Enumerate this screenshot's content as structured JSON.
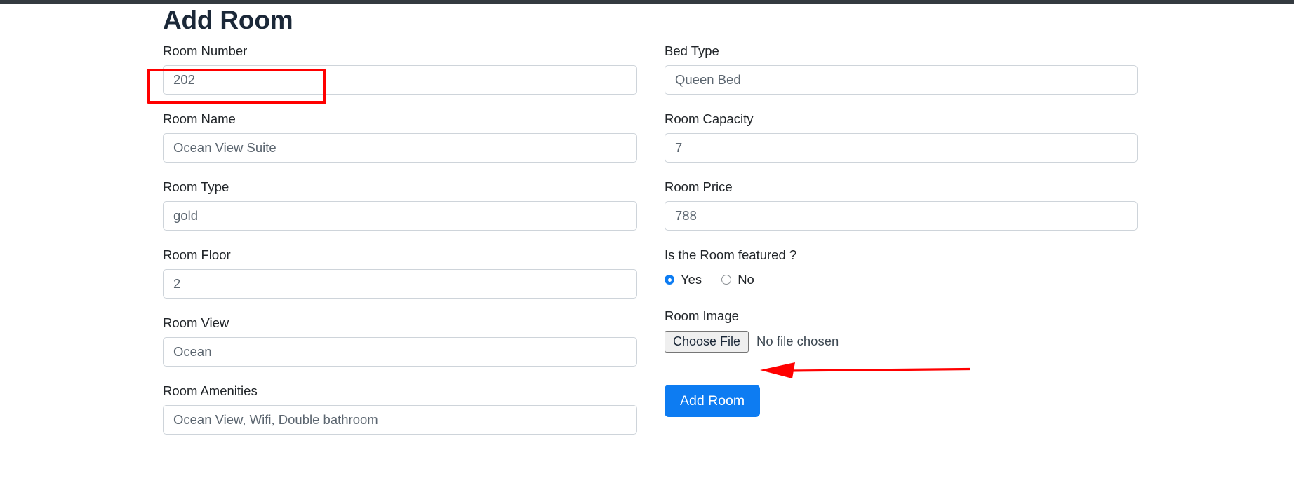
{
  "page": {
    "title": "Add Room"
  },
  "form": {
    "left_fields": [
      {
        "label": "Room Number",
        "value": "202",
        "name": "room-number"
      },
      {
        "label": "Room Name",
        "value": "Ocean View Suite",
        "name": "room-name"
      },
      {
        "label": "Room Type",
        "value": "gold",
        "name": "room-type"
      },
      {
        "label": "Room Floor",
        "value": "2",
        "name": "room-floor"
      },
      {
        "label": "Room View",
        "value": "Ocean",
        "name": "room-view"
      },
      {
        "label": "Room Amenities",
        "value": "Ocean View, Wifi, Double bathroom",
        "name": "room-amenities"
      }
    ],
    "right_fields": [
      {
        "label": "Bed Type",
        "value": "Queen Bed",
        "name": "bed-type"
      },
      {
        "label": "Room Capacity",
        "value": "7",
        "name": "room-capacity"
      },
      {
        "label": "Room Price",
        "value": "788",
        "name": "room-price"
      }
    ],
    "featured": {
      "label": "Is the Room featured ?",
      "options": [
        {
          "label": "Yes",
          "selected": true
        },
        {
          "label": "No",
          "selected": false
        }
      ]
    },
    "room_image": {
      "label": "Room Image",
      "button_label": "Choose File",
      "status": "No file chosen"
    },
    "submit": {
      "label": "Add Room"
    }
  },
  "annotations": {
    "highlight_box": {
      "target": "room-number-input"
    },
    "arrow": {
      "target": "choose-file-status"
    },
    "color": "#ff0000"
  },
  "colors": {
    "accent": "#0d7cf2",
    "annotation": "#ff0000",
    "border": "#ced4da",
    "text": "#212529",
    "value_text": "#5c6670"
  }
}
